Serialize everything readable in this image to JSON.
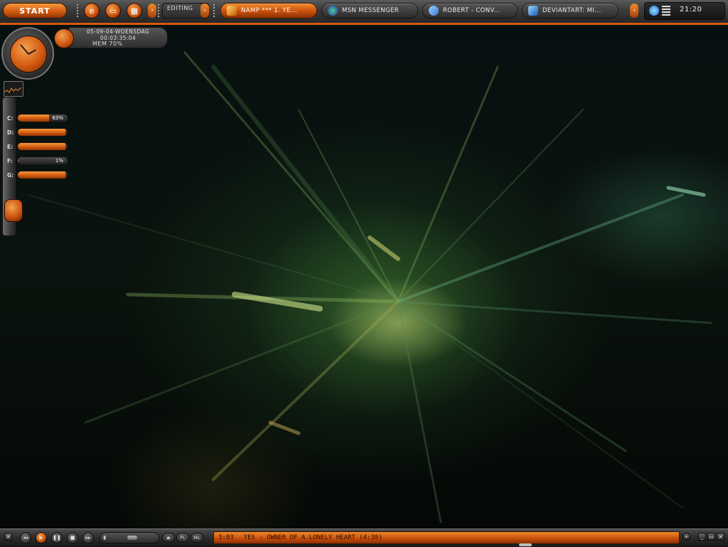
{
  "taskbar": {
    "start_label": "START",
    "editing_label": "EDITING",
    "tasks": [
      {
        "label": "NAMP *** 1. YE...",
        "icon": "winamp-icon",
        "active": true
      },
      {
        "label": "MSN MESSENGER",
        "icon": "msn-icon",
        "active": false
      },
      {
        "label": "ROBERT - CONV...",
        "icon": "chat-icon",
        "active": false
      },
      {
        "label": "DEVIANTART: MI...",
        "icon": "ie-icon",
        "active": false
      }
    ],
    "clock": "21:20"
  },
  "sysmon": {
    "date_line1": "05-09-04-WOENSDAG",
    "date_line2": "00:03:35:04",
    "mem": "MEM 70%",
    "drives": [
      {
        "letter": "C:",
        "value": "63%",
        "fill": 0.63
      },
      {
        "letter": "D:",
        "value": "",
        "fill": 0.95
      },
      {
        "letter": "E:",
        "value": "",
        "fill": 0.95
      },
      {
        "letter": "F:",
        "value": "1%",
        "fill": 0.01
      },
      {
        "letter": "G:",
        "value": "",
        "fill": 0.95
      }
    ]
  },
  "player": {
    "time": "3:03",
    "track": "YES - OWNER OF A LONELY HEART (4:30)",
    "pl_label": "PL",
    "ml_label": "ML"
  },
  "colors": {
    "accent": "#d45a10",
    "chrome": "#3a3a3a"
  }
}
